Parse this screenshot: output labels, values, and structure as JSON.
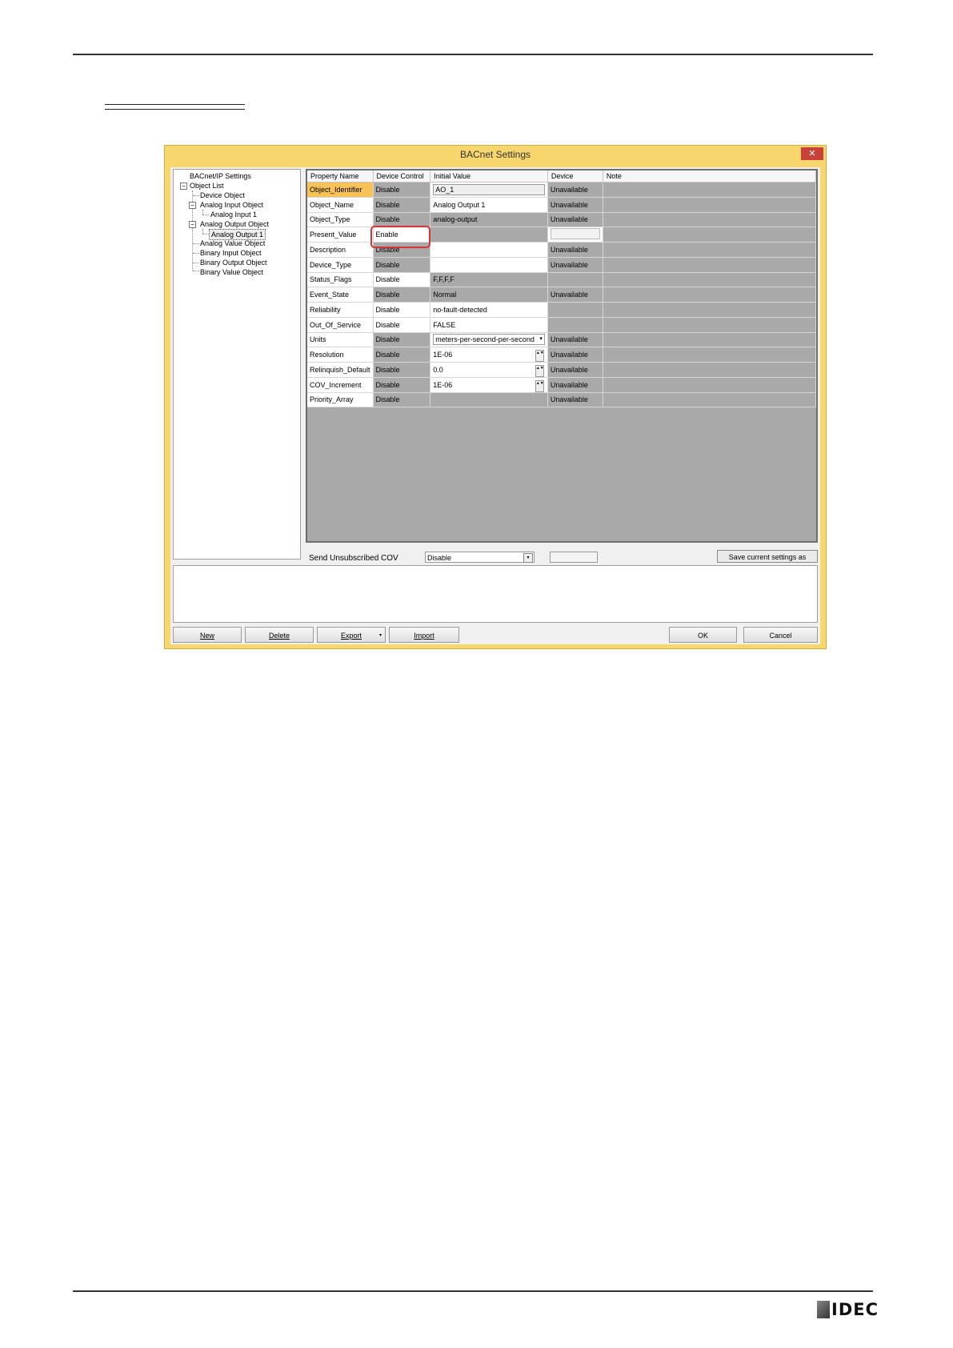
{
  "dialog": {
    "title": "BACnet Settings",
    "close_glyph": "✕"
  },
  "tree": {
    "root_label": "BACnet/IP Settings",
    "object_list_label": "Object List",
    "toggle_glyph": "−",
    "items": [
      "Device Object",
      "Analog Input Object",
      "Analog Input 1",
      "Analog Output Object",
      "Analog Output 1",
      "Analog Value Object",
      "Binary Input Object",
      "Binary Output Object",
      "Binary Value Object"
    ]
  },
  "grid": {
    "columns": [
      "Property Name",
      "Device Control",
      "Initial Value",
      "Device",
      "Note"
    ],
    "rows": [
      {
        "name": "Object_Identifier",
        "control": "Disable",
        "initial": "AO_1",
        "device": "Unavailable"
      },
      {
        "name": "Object_Name",
        "control": "Disable",
        "initial": "Analog Output 1",
        "device": "Unavailable"
      },
      {
        "name": "Object_Type",
        "control": "Disable",
        "initial": "analog-output",
        "device": "Unavailable"
      },
      {
        "name": "Present_Value",
        "control": "Enable",
        "initial": "",
        "device": ""
      },
      {
        "name": "Description",
        "control": "Disable",
        "initial": "",
        "device": "Unavailable"
      },
      {
        "name": "Device_Type",
        "control": "Disable",
        "initial": "",
        "device": "Unavailable"
      },
      {
        "name": "Status_Flags",
        "control": "Disable",
        "initial": "F,F,F,F",
        "device": ""
      },
      {
        "name": "Event_State",
        "control": "Disable",
        "initial": "Normal",
        "device": "Unavailable"
      },
      {
        "name": "Reliability",
        "control": "Disable",
        "initial": "no-fault-detected",
        "device": ""
      },
      {
        "name": "Out_Of_Service",
        "control": "Disable",
        "initial": "FALSE",
        "device": ""
      },
      {
        "name": "Units",
        "control": "Disable",
        "initial": "meters-per-second-per-second",
        "device": "Unavailable"
      },
      {
        "name": "Resolution",
        "control": "Disable",
        "initial": "1E-06",
        "device": "Unavailable"
      },
      {
        "name": "Relinquish_Default",
        "control": "Disable",
        "initial": "0.0",
        "device": "Unavailable"
      },
      {
        "name": "COV_Increment",
        "control": "Disable",
        "initial": "1E-06",
        "device": "Unavailable"
      },
      {
        "name": "Priority_Array",
        "control": "Disable",
        "initial": "",
        "device": "Unavailable"
      }
    ]
  },
  "cov": {
    "label": "Send Unsubscribed COV",
    "value": "Disable"
  },
  "buttons": {
    "save_default_label": "Save current settings as default",
    "new_label": "New",
    "delete_label": "Delete",
    "export_label": "Export",
    "import_label": "Import",
    "ok_label": "OK",
    "cancel_label": "Cancel"
  },
  "glyphs": {
    "dropdown": "▾",
    "spin": "▲▼"
  },
  "footer": {
    "logo_text": "IDEC"
  },
  "colors": {
    "dialog_frame": "#f7d66d",
    "active_row": "#f7c25a",
    "highlight_box": "#d8323a",
    "disabled_cell": "#a9a9a9"
  }
}
